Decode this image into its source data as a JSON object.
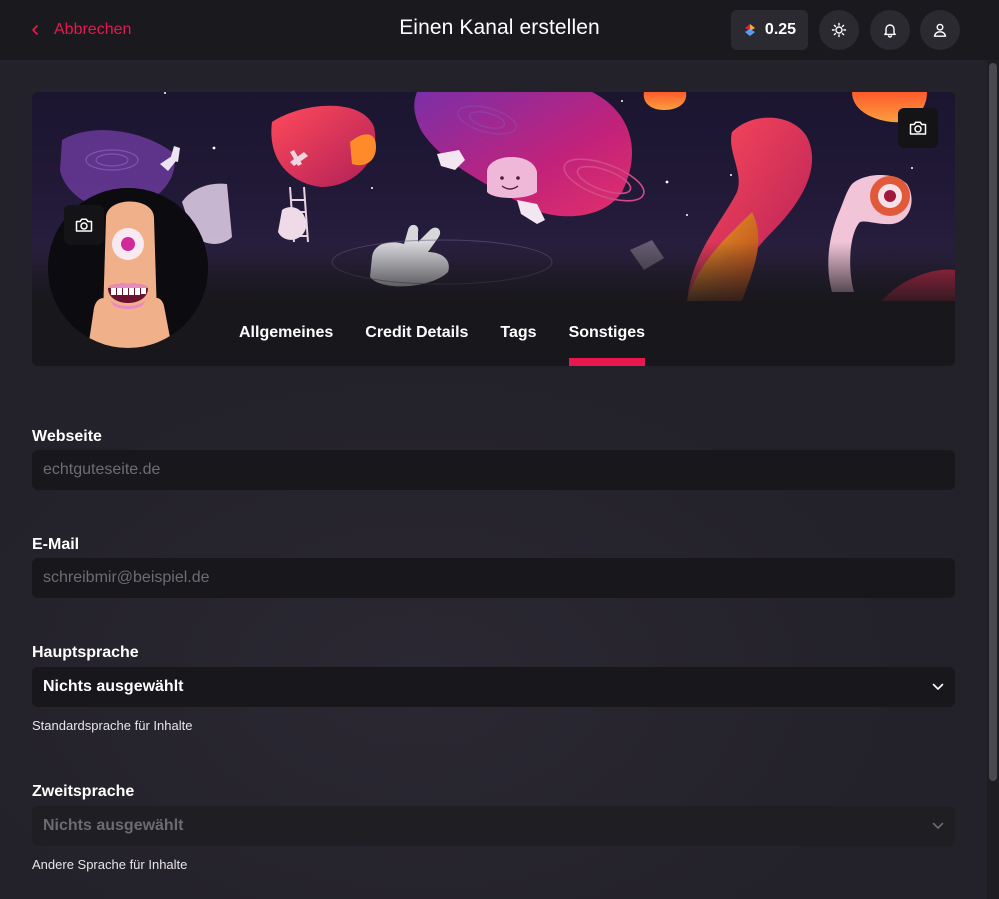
{
  "header": {
    "cancel_label": "Abbrechen",
    "title": "Einen Kanal erstellen",
    "credits": "0.25"
  },
  "tabs": [
    {
      "label": "Allgemeines",
      "active": false
    },
    {
      "label": "Credit Details",
      "active": false
    },
    {
      "label": "Tags",
      "active": false
    },
    {
      "label": "Sonstiges",
      "active": true
    }
  ],
  "form": {
    "website": {
      "label": "Webseite",
      "value": "",
      "placeholder": "echtguteseite.de"
    },
    "email": {
      "label": "E-Mail",
      "value": "",
      "placeholder": "schreibmir@beispiel.de"
    },
    "primary_language": {
      "label": "Hauptsprache",
      "value": "Nichts ausgewählt",
      "hint": "Standardsprache für Inhalte"
    },
    "secondary_language": {
      "label": "Zweitsprache",
      "value": "Nichts ausgewählt",
      "hint": "Andere Sprache für Inhalte",
      "disabled": true
    }
  },
  "colors": {
    "accent": "#e8174f",
    "background": "#232129",
    "header": "#1a191d",
    "card": "#18171b"
  },
  "icons": [
    "chevron-left-icon",
    "lbry-credits-icon",
    "sun-icon",
    "bell-icon",
    "user-icon",
    "camera-icon",
    "chevron-down-icon"
  ]
}
